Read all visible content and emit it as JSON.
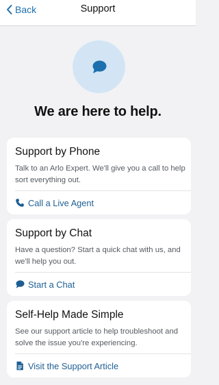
{
  "nav": {
    "back_label": "Back",
    "title": "Support"
  },
  "hero": {
    "icon": "chat-bubble-icon",
    "headline": "We are here to help."
  },
  "cards": [
    {
      "title": "Support by Phone",
      "description": "Talk to an Arlo Expert. We'll give you a call to help sort everything out.",
      "action_icon": "phone-icon",
      "action_label": "Call a Live Agent"
    },
    {
      "title": "Support by Chat",
      "description": "Have a question? Start a quick chat with us, and we'll help you out.",
      "action_icon": "chat-bubble-icon",
      "action_label": "Start a Chat"
    },
    {
      "title": "Self-Help Made Simple",
      "description": "See our support article to help troubleshoot and solve the issue you're experiencing.",
      "action_icon": "document-icon",
      "action_label": "Visit the Support Article"
    }
  ],
  "colors": {
    "accent": "#1e5f93",
    "hero_circle": "#d3e5f5",
    "background": "#f2f2f4"
  }
}
